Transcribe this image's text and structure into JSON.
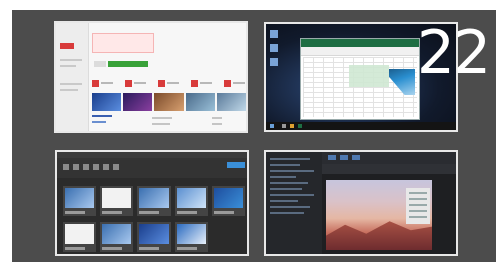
{
  "task_view": {
    "badge_number": "22",
    "colors": {
      "panel_bg": "#4c4c4c",
      "tile_border": "#e8e8e8",
      "accent_red": "#d83b3b",
      "accent_green": "#39a239",
      "excel_green": "#1e6e43",
      "accent_blue": "#3a8fd8"
    },
    "windows": [
      {
        "name": "window-thumbnail-1",
        "theme": "light",
        "selected": false
      },
      {
        "name": "window-thumbnail-2",
        "theme": "desktop-excel",
        "selected": true
      },
      {
        "name": "window-thumbnail-3",
        "theme": "dark-gallery",
        "selected": false
      },
      {
        "name": "window-thumbnail-4",
        "theme": "dark-image-editor",
        "selected": false
      }
    ]
  }
}
